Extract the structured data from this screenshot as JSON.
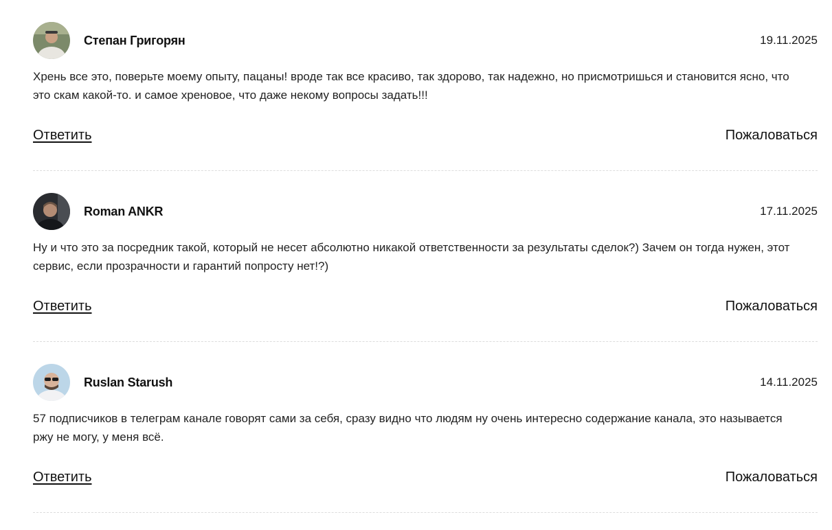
{
  "comments": [
    {
      "author": "Степан Григорян",
      "date": "19.11.2025",
      "text": "Хрень все это, поверьте моему опыту, пацаны! вроде так все красиво, так здорово, так надежно, но присмотришься и становится ясно, что это скам какой-то. и самое хреновое, что даже некому вопросы задать!!!",
      "reply_label": "Ответить",
      "report_label": "Пожаловаться",
      "avatar": {
        "bg": "#7c8a6a",
        "skin": "#c9a184",
        "shirt": "#e8e6e0"
      }
    },
    {
      "author": "Roman ANKR",
      "date": "17.11.2025",
      "text": "Ну и что это за посредник такой, который не несет абсолютно никакой ответственности за результаты сделок?) Зачем он тогда нужен, этот сервис, если прозрачности и гарантий попросту нет!?)",
      "reply_label": "Ответить",
      "report_label": "Пожаловаться",
      "avatar": {
        "bg": "#2a2c30",
        "skin": "#b48c74",
        "shirt": "#15171a"
      }
    },
    {
      "author": "Ruslan Starush",
      "date": "14.11.2025",
      "text": "57 подписчиков в телеграм канале говорят сами за себя, сразу видно что людям ну очень интересно содержание канала, это называется ржу не могу, у меня всё.",
      "reply_label": "Ответить",
      "report_label": "Пожаловаться",
      "avatar": {
        "bg": "#bcd6e8",
        "skin": "#d8b39a",
        "shirt": "#f2f2f4"
      }
    }
  ]
}
